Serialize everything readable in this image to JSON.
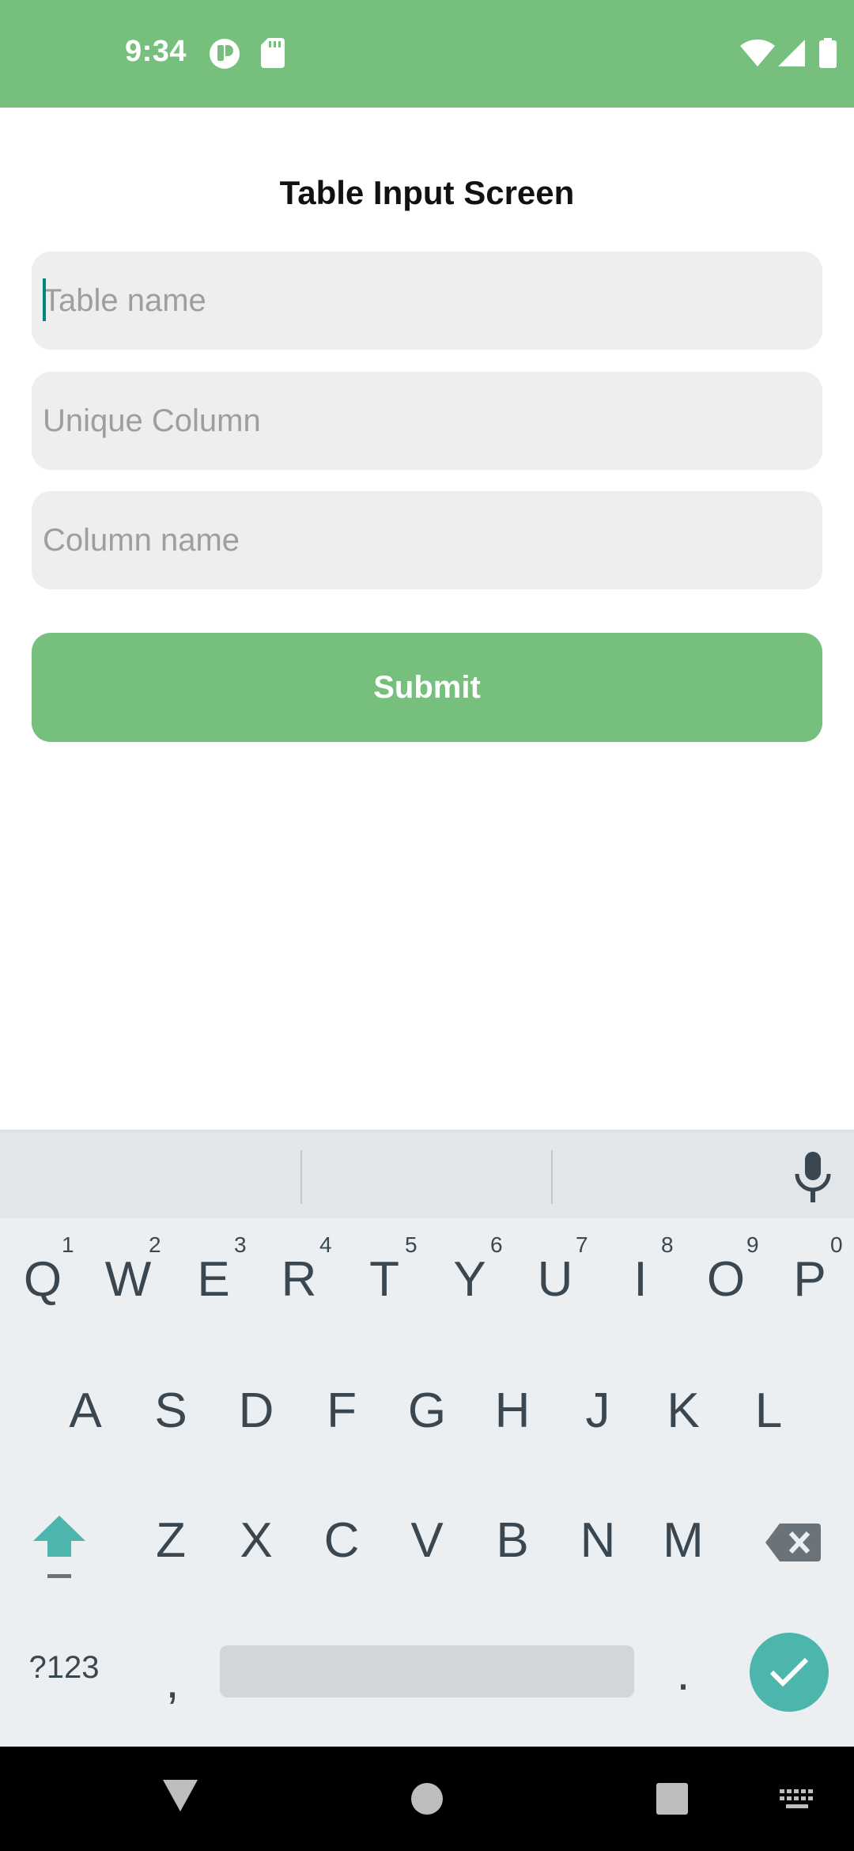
{
  "status_bar": {
    "time": "9:34",
    "icons": [
      "app-notification-icon",
      "sd-card-icon",
      "wifi-icon",
      "signal-icon",
      "battery-icon"
    ]
  },
  "screen": {
    "title": "Table Input Screen",
    "fields": [
      {
        "placeholder": "Table name",
        "value": ""
      },
      {
        "placeholder": "Unique Column",
        "value": ""
      },
      {
        "placeholder": "Column name",
        "value": ""
      }
    ],
    "submit_label": "Submit"
  },
  "keyboard": {
    "row1": [
      {
        "key": "Q",
        "hint": "1"
      },
      {
        "key": "W",
        "hint": "2"
      },
      {
        "key": "E",
        "hint": "3"
      },
      {
        "key": "R",
        "hint": "4"
      },
      {
        "key": "T",
        "hint": "5"
      },
      {
        "key": "Y",
        "hint": "6"
      },
      {
        "key": "U",
        "hint": "7"
      },
      {
        "key": "I",
        "hint": "8"
      },
      {
        "key": "O",
        "hint": "9"
      },
      {
        "key": "P",
        "hint": "0"
      }
    ],
    "row2": [
      "A",
      "S",
      "D",
      "F",
      "G",
      "H",
      "J",
      "K",
      "L"
    ],
    "row3": [
      "Z",
      "X",
      "C",
      "V",
      "B",
      "N",
      "M"
    ],
    "symbols_label": "?123",
    "comma": ",",
    "period": "."
  },
  "colors": {
    "accent": "#76bf7d",
    "field_bg": "#eeeeee",
    "enter_key": "#4cb6ac",
    "cursor": "#00897b"
  }
}
